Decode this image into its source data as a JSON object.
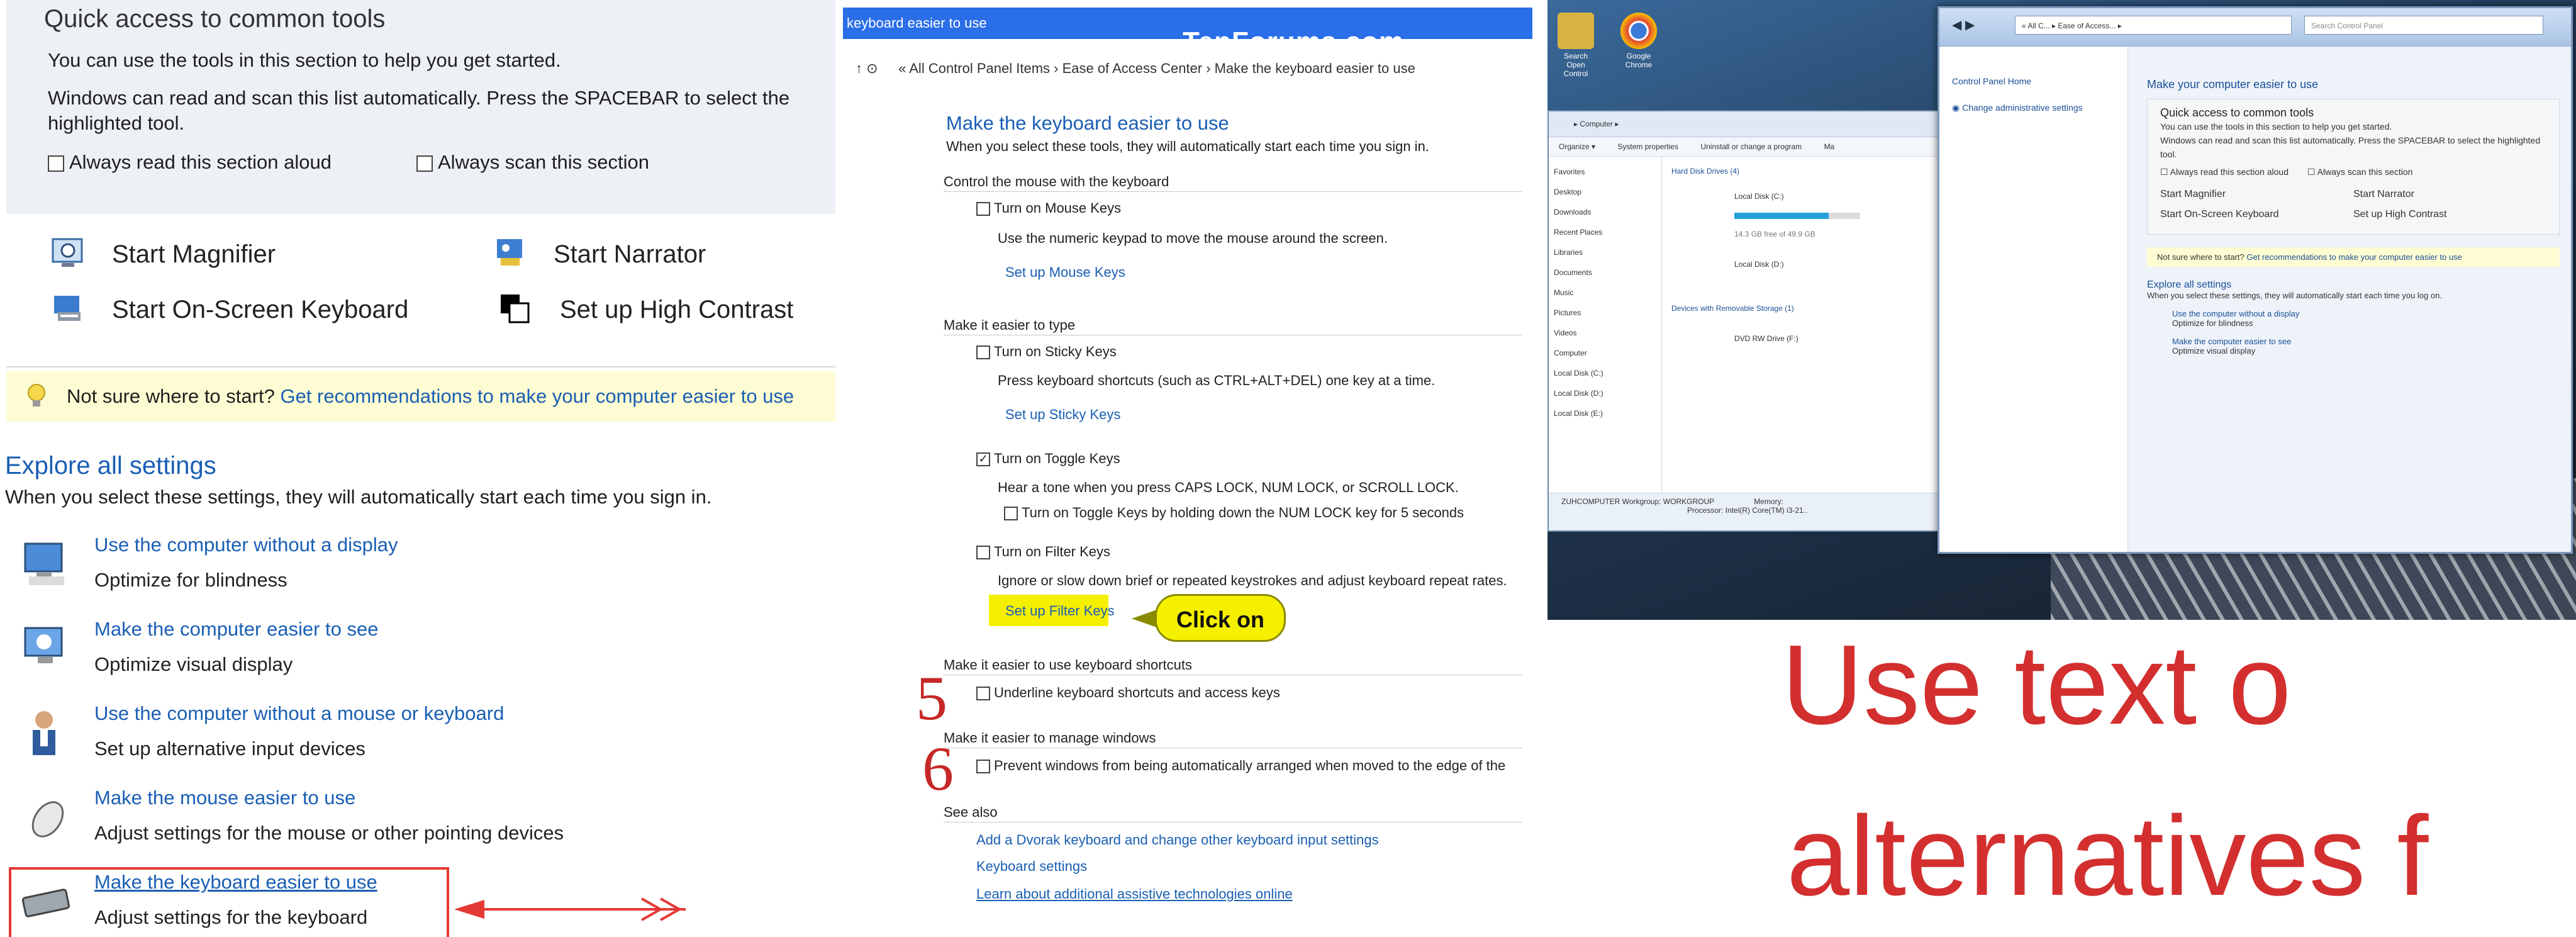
{
  "panel1": {
    "quick_access_title": "Quick access to common tools",
    "desc1": "You can use the tools in this section to help you get started.",
    "desc2": "Windows can read and scan this list automatically.  Press the SPACEBAR to select the highlighted tool.",
    "cb_read": "Always read this section aloud",
    "cb_scan": "Always scan this section",
    "tools": {
      "magnifier": "Start Magnifier",
      "narrator": "Start Narrator",
      "osk": "Start On-Screen Keyboard",
      "contrast": "Set up High Contrast"
    },
    "tip_prefix": "Not sure where to start?",
    "tip_link": "Get recommendations to make your computer easier to use",
    "explore_title": "Explore all settings",
    "explore_desc": "When you select these settings, they will automatically start each time you sign in.",
    "items": [
      {
        "title": "Use the computer without a display",
        "sub": "Optimize for blindness"
      },
      {
        "title": "Make the computer easier to see",
        "sub": "Optimize visual display"
      },
      {
        "title": "Use the computer without a mouse or keyboard",
        "sub": "Set up alternative input devices"
      },
      {
        "title": "Make the mouse easier to use",
        "sub": "Adjust settings for the mouse or other pointing devices"
      },
      {
        "title": "Make the keyboard easier to use",
        "sub": "Adjust settings for the keyboard"
      }
    ]
  },
  "panel2": {
    "window_title": "keyboard easier to use",
    "watermark": "TenForums.com",
    "breadcrumb": "« All Control Panel Items  ›  Ease of Access Center  ›  Make the keyboard easier to use",
    "heading": "Make the keyboard easier to use",
    "lead": "When you select these tools, they will automatically start each time you sign in.",
    "sec_mouse": "Control the mouse with the keyboard",
    "mouse_keys": "Turn on Mouse Keys",
    "mouse_keys_desc": "Use the numeric keypad to move the mouse around the screen.",
    "mouse_keys_link": "Set up Mouse Keys",
    "sec_type": "Make it easier to type",
    "sticky": "Turn on Sticky Keys",
    "sticky_desc": "Press keyboard shortcuts (such as CTRL+ALT+DEL) one key at a time.",
    "sticky_link": "Set up Sticky Keys",
    "toggle": "Turn on Toggle Keys",
    "toggle_desc": "Hear a tone when you press CAPS LOCK, NUM LOCK, or SCROLL LOCK.",
    "toggle_sub": "Turn on Toggle Keys by holding down the NUM LOCK key for 5 seconds",
    "filter": "Turn on Filter Keys",
    "filter_desc": "Ignore or slow down brief or repeated keystrokes and adjust keyboard repeat rates.",
    "filter_link": "Set up Filter Keys",
    "callout": "Click on",
    "sec_shortcuts": "Make it easier to use keyboard shortcuts",
    "underline": "Underline keyboard shortcuts and access keys",
    "sec_windows": "Make it easier to manage windows",
    "prevent": "Prevent windows from being automatically arranged when moved to the edge of the",
    "num5": "5",
    "num6": "6",
    "see_also": "See also",
    "see1": "Add a Dvorak keyboard and change other keyboard input settings",
    "see2": "Keyboard settings",
    "see3": "Learn about additional assistive technologies online"
  },
  "panel3": {
    "desktop_icons": [
      "Search Open Control",
      "Google Chrome"
    ],
    "explorer": {
      "address": "▸ Computer ▸",
      "menu": [
        "Organize ▾",
        "System properties",
        "Uninstall or change a program",
        "Ma"
      ],
      "nav": [
        "Favorites",
        "Desktop",
        "Downloads",
        "Recent Places",
        "Libraries",
        "Documents",
        "Music",
        "Pictures",
        "Videos",
        "Computer",
        "Local Disk (C:)",
        "Local Disk (D:)",
        "Local Disk (E:)"
      ],
      "hdd_header": "Hard Disk Drives (4)",
      "disk1": "Local Disk (C:)",
      "disk1_free": "14.3 GB free of 49.9 GB",
      "disk2": "Local Disk (D:)",
      "removable_header": "Devices with Removable Storage (1)",
      "dvd": "DVD RW Drive (F:)",
      "footer_pc": "ZUHCOMPUTER  Workgroup: WORKGROUP",
      "footer_proc": "Processor: Intel(R) Core(TM) i3-21..",
      "footer_mem": "Memory:"
    },
    "cp": {
      "address": "« All C... ▸ Ease of Access... ▸",
      "search": "Search Control Panel",
      "side1": "Control Panel Home",
      "side2": "Change administrative settings",
      "heading": "Make your computer easier to use",
      "qa_title": "Quick access to common tools",
      "qa_desc": "You can use the tools in this section to help you get started.",
      "qa_desc2": "Windows can read and scan this list automatically.  Press the SPACEBAR to select the highlighted tool.",
      "cb1": "Always read this section aloud",
      "cb2": "Always scan this section",
      "t1": "Start Magnifier",
      "t2": "Start Narrator",
      "t3": "Start On-Screen Keyboard",
      "t4": "Set up High Contrast",
      "tip": "Not sure where to start?",
      "tip_link": "Get recommendations to make your computer easier to use",
      "explore": "Explore all settings",
      "explore_desc": "When you select these settings, they will automatically start each time you log on.",
      "i1": "Use the computer without a display",
      "i1s": "Optimize for blindness",
      "i2": "Make the computer easier to see",
      "i2s": "Optimize visual display"
    },
    "overlay_line1": "Use text o",
    "overlay_line2": "alternatives f"
  },
  "colors": {
    "link": "#1a5fb4",
    "tip_bg": "#fefcd3",
    "highlight": "#f5f000",
    "accent_red": "#d32f2f"
  }
}
